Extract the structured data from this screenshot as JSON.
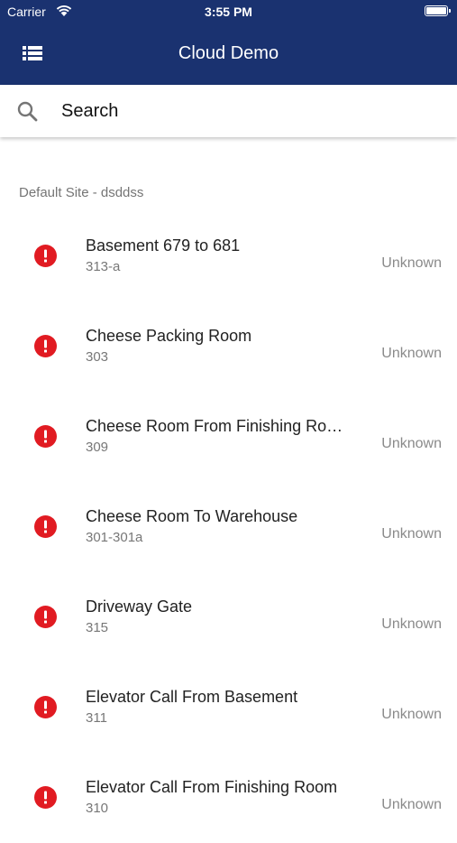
{
  "status_bar": {
    "carrier": "Carrier",
    "time": "3:55 PM"
  },
  "header": {
    "title": "Cloud Demo",
    "menu_icon": "list-menu-icon",
    "background_color": "#1a3270"
  },
  "search": {
    "placeholder": "Search",
    "value": ""
  },
  "section": {
    "title": "Default Site - dsddss"
  },
  "items": [
    {
      "title": "Basement 679 to 681",
      "subtitle": "313-a",
      "status": "Unknown",
      "icon": "alert-icon"
    },
    {
      "title": "Cheese Packing Room",
      "subtitle": "303",
      "status": "Unknown",
      "icon": "alert-icon"
    },
    {
      "title": "Cheese Room From Finishing Ro…",
      "subtitle": "309",
      "status": "Unknown",
      "icon": "alert-icon"
    },
    {
      "title": "Cheese Room To Warehouse",
      "subtitle": "301-301a",
      "status": "Unknown",
      "icon": "alert-icon"
    },
    {
      "title": "Driveway Gate",
      "subtitle": "315",
      "status": "Unknown",
      "icon": "alert-icon"
    },
    {
      "title": "Elevator Call From Basement",
      "subtitle": "311",
      "status": "Unknown",
      "icon": "alert-icon"
    },
    {
      "title": "Elevator Call From Finishing Room",
      "subtitle": "310",
      "status": "Unknown",
      "icon": "alert-icon"
    }
  ],
  "colors": {
    "alert": "#e11b22",
    "header": "#1a3270"
  }
}
